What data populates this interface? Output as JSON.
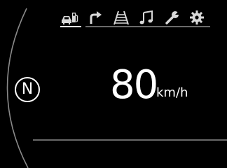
{
  "gear": {
    "letter": "N"
  },
  "speed": {
    "value": "80",
    "unit": "km/h"
  },
  "menu": {
    "active_index": 0,
    "items": [
      {
        "icon": "trip-computer-icon"
      },
      {
        "icon": "navigation-turn-arrow-icon"
      },
      {
        "icon": "lane-road-icon"
      },
      {
        "icon": "music-note-icon"
      },
      {
        "icon": "wrench-icon"
      },
      {
        "icon": "settings-gear-icon"
      }
    ]
  },
  "colors": {
    "background": "#000000",
    "text": "#ffffff",
    "active_underline": "#ffffff",
    "inactive_underline": "#6a6a6a",
    "frame_line": "#8a8a8a",
    "icon": "#d8d8d8"
  }
}
